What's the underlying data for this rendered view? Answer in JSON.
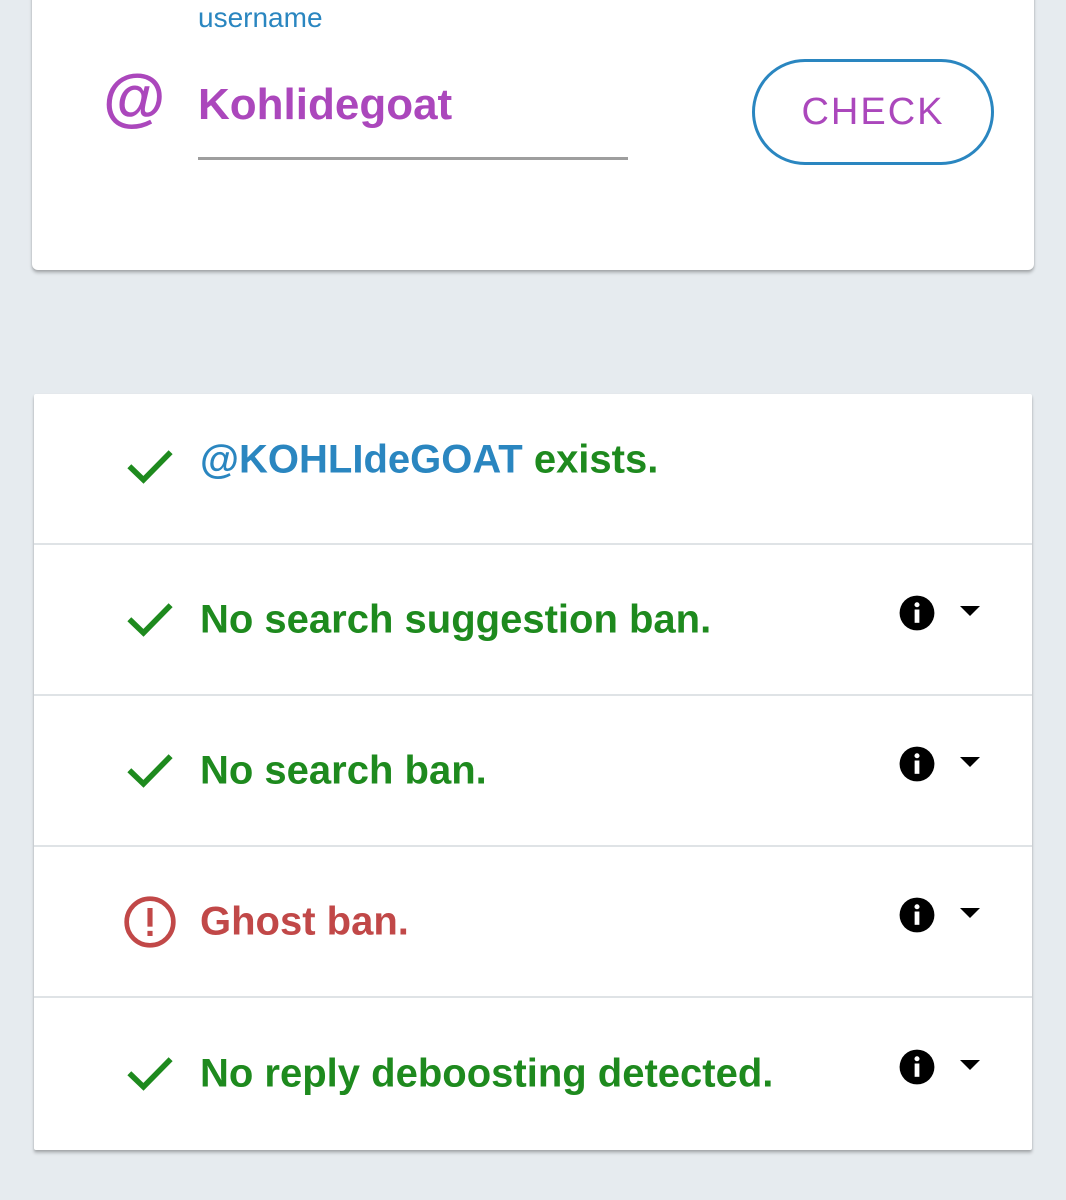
{
  "colors": {
    "accent_purple": "#ab47bc",
    "accent_blue": "#2a86c0",
    "success_green": "#1e8a1e",
    "error_red": "#c14848",
    "background": "#e6ebef"
  },
  "search": {
    "field_label": "username",
    "at_symbol": "@",
    "input_value": "Kohlidegoat",
    "check_label": "CHECK"
  },
  "results": [
    {
      "status": "ok",
      "handle": "@KOHLIdeGOAT",
      "text": " exists.",
      "has_info": false,
      "icon": "check-icon"
    },
    {
      "status": "ok",
      "text": "No search suggestion ban.",
      "has_info": true,
      "icon": "check-icon"
    },
    {
      "status": "ok",
      "text": "No search ban.",
      "has_info": true,
      "icon": "check-icon"
    },
    {
      "status": "bad",
      "text": "Ghost ban.",
      "has_info": true,
      "icon": "alert-circle-icon"
    },
    {
      "status": "ok",
      "text": "No reply deboosting detected.",
      "has_info": true,
      "icon": "check-icon"
    }
  ]
}
